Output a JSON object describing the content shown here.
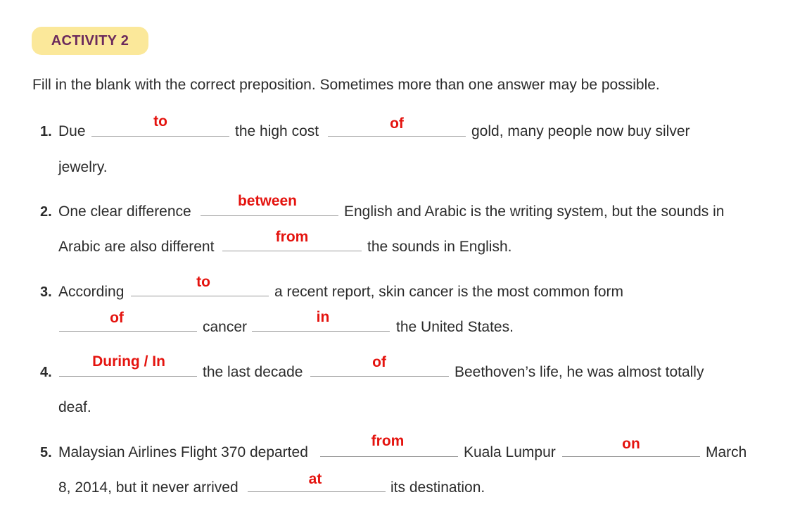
{
  "header": {
    "badge": "ACTIVITY 2"
  },
  "instruction": "Fill in the blank with the correct preposition. Sometimes more than one answer may be possible.",
  "accent_color": "#e4130e",
  "badge_color": "#fbe89a",
  "items": [
    {
      "number": "1.",
      "text": [
        "Due",
        "the high cost",
        "gold, many people now buy silver",
        "jewelry."
      ],
      "answers": [
        "to",
        "of"
      ]
    },
    {
      "number": "2.",
      "text": [
        "One clear difference",
        "English and Arabic is the writing system, but the sounds in",
        "Arabic are also different",
        "the sounds in English."
      ],
      "answers": [
        "between",
        "from"
      ]
    },
    {
      "number": "3.",
      "text": [
        "According",
        "a recent report, skin cancer is the most common form",
        "cancer",
        "the United States."
      ],
      "answers": [
        "to",
        "of",
        "in"
      ]
    },
    {
      "number": "4.",
      "text": [
        "the last decade",
        "Beethoven’s life, he was almost totally",
        "deaf."
      ],
      "answers": [
        "During / In",
        "of"
      ]
    },
    {
      "number": "5.",
      "text": [
        "Malaysian Airlines Flight 370 departed",
        "Kuala Lumpur",
        "March",
        "8, 2014, but it never arrived",
        "its destination."
      ],
      "answers": [
        "from",
        "on",
        "at"
      ]
    }
  ]
}
